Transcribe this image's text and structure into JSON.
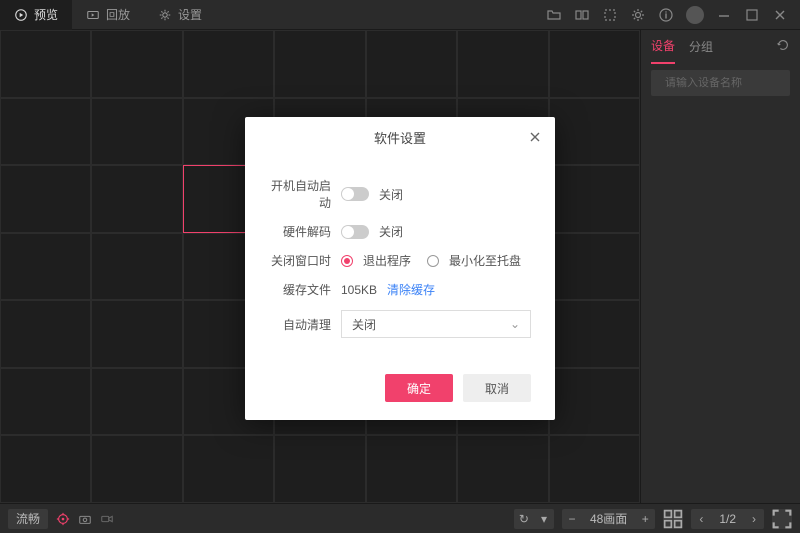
{
  "topbar": {
    "tabs": [
      {
        "label": "预览"
      },
      {
        "label": "回放"
      },
      {
        "label": "设置"
      }
    ]
  },
  "side": {
    "tabs": [
      {
        "label": "设备"
      },
      {
        "label": "分组"
      }
    ],
    "search_placeholder": "请输入设备名称"
  },
  "bottom": {
    "quality": "流畅",
    "layout_label": "48画面",
    "page_current": "1/2"
  },
  "dialog": {
    "title": "软件设置",
    "rows": {
      "autostart": {
        "label": "开机自动启动",
        "state": "关闭"
      },
      "hwdecode": {
        "label": "硬件解码",
        "state": "关闭"
      },
      "onclose": {
        "label": "关闭窗口时",
        "opt_exit": "退出程序",
        "opt_tray": "最小化至托盘"
      },
      "cache": {
        "label": "缓存文件",
        "size": "105KB",
        "clear": "清除缓存"
      },
      "autoclean": {
        "label": "自动清理",
        "value": "关闭"
      }
    },
    "buttons": {
      "ok": "确定",
      "cancel": "取消"
    }
  }
}
